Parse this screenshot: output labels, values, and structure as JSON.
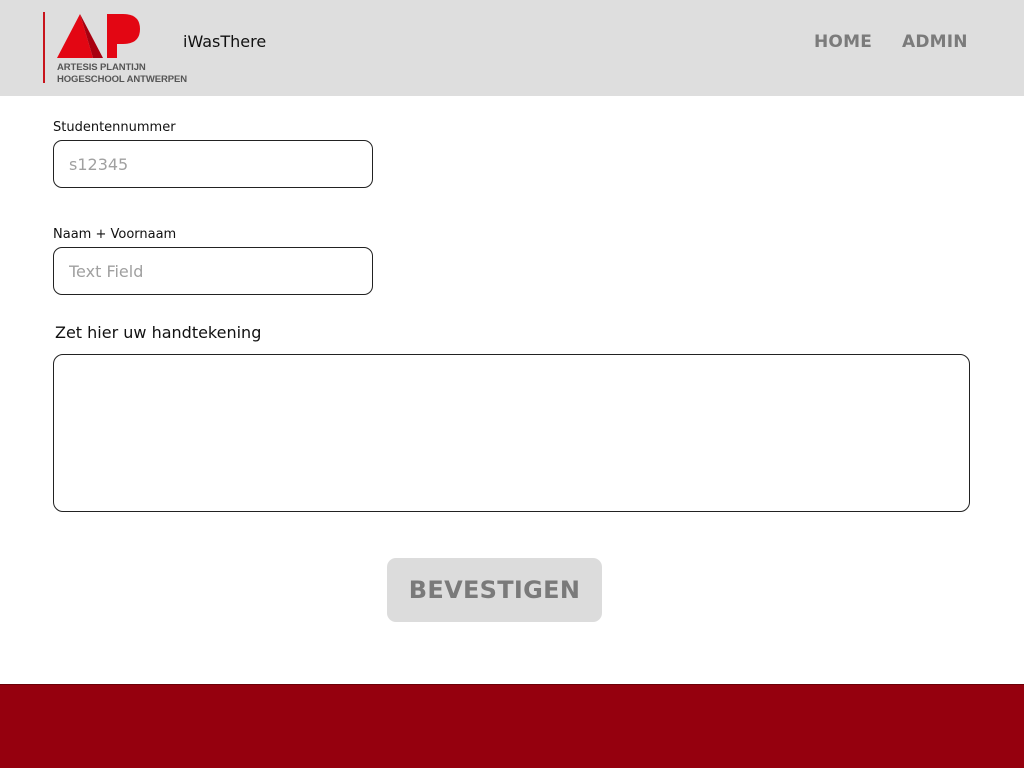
{
  "header": {
    "logo": {
      "line1": "ARTESIS PLANTIJN",
      "line2": "HOGESCHOOL ANTWERPEN"
    },
    "app_title": "iWasThere",
    "nav": {
      "home": "HOME",
      "admin": "ADMIN"
    }
  },
  "form": {
    "student_number": {
      "label": "Studentennummer",
      "placeholder": "s12345",
      "value": ""
    },
    "name": {
      "label": "Naam + Voornaam",
      "placeholder": "Text Field",
      "value": ""
    },
    "signature": {
      "label": "Zet hier uw handtekening"
    },
    "submit_label": "BEVESTIGEN"
  },
  "colors": {
    "header_bg": "#dedede",
    "brand_red": "#e30613",
    "footer_bg": "#95000e",
    "button_bg": "#dcdcdc",
    "nav_text": "#7b7b7b"
  }
}
